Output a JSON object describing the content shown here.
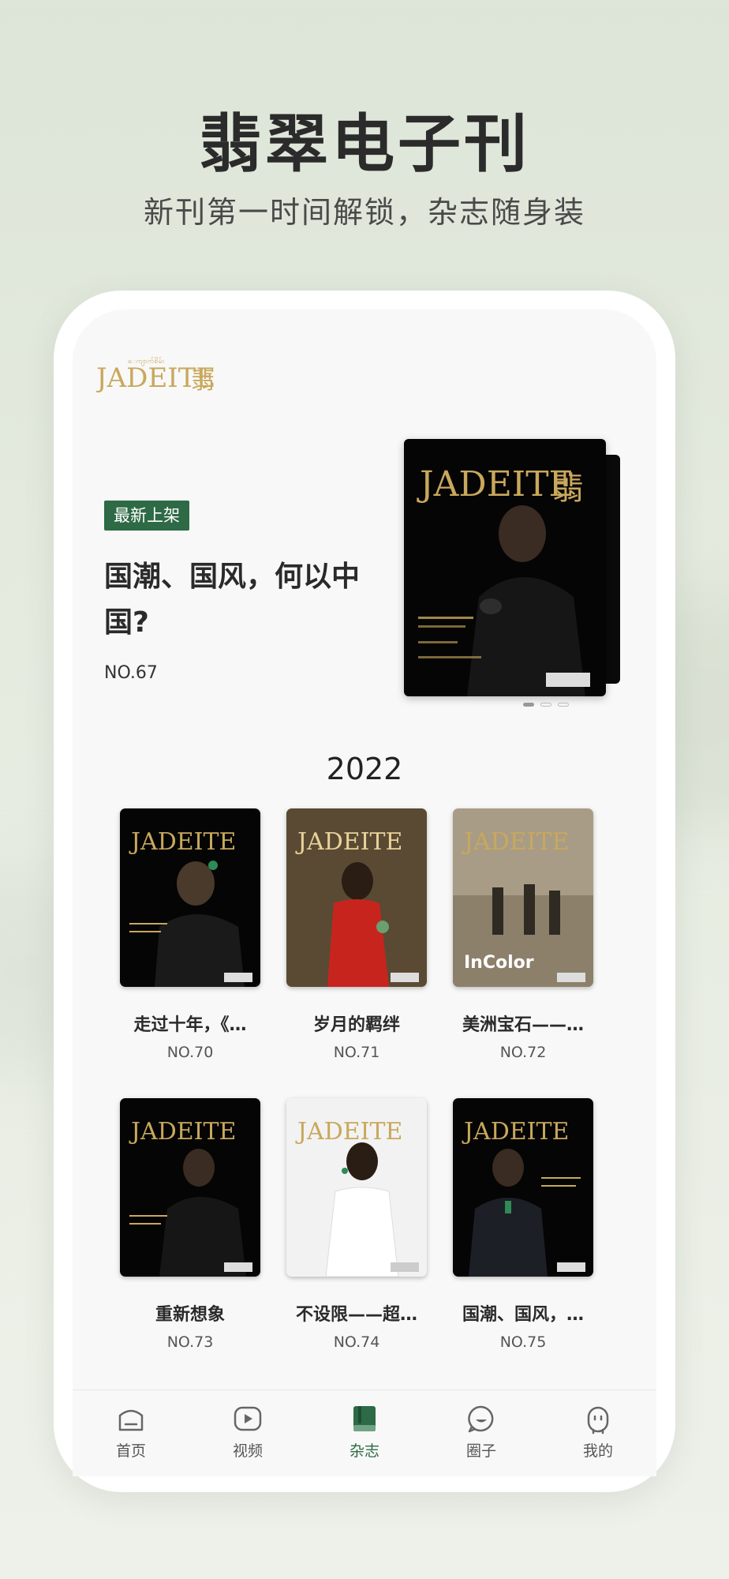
{
  "promo": {
    "headline": "翡翠电子刊",
    "subline": "新刊第一时间解锁，杂志随身装"
  },
  "brand": {
    "logo_text": "JADEITE翡翠",
    "accent_color": "#2d6a45",
    "gold_color": "#c9a85c"
  },
  "hero": {
    "badge": "最新上架",
    "title": "国潮、国风，何以中国?",
    "issue": "NO.67",
    "pagination": {
      "count": 3,
      "active": 0
    }
  },
  "section": {
    "year": "2022"
  },
  "magazines": [
    {
      "title": "走过十年，《…",
      "issue": "NO.70",
      "cover_bg": "#050505"
    },
    {
      "title": "岁月的羁绊",
      "issue": "NO.71",
      "cover_bg": "#6b5a3e"
    },
    {
      "title": "美洲宝石——…",
      "issue": "NO.72",
      "cover_bg": "#a89c86"
    },
    {
      "title": "重新想象",
      "issue": "NO.73",
      "cover_bg": "#050505"
    },
    {
      "title": "不设限——超…",
      "issue": "NO.74",
      "cover_bg": "#f2f2f2"
    },
    {
      "title": "国潮、国风，…",
      "issue": "NO.75",
      "cover_bg": "#050505"
    }
  ],
  "tabbar": {
    "items": [
      {
        "label": "首页",
        "icon": "home-icon",
        "active": false
      },
      {
        "label": "视频",
        "icon": "video-icon",
        "active": false
      },
      {
        "label": "杂志",
        "icon": "book-icon",
        "active": true
      },
      {
        "label": "圈子",
        "icon": "chat-icon",
        "active": false
      },
      {
        "label": "我的",
        "icon": "profile-icon",
        "active": false
      }
    ]
  }
}
